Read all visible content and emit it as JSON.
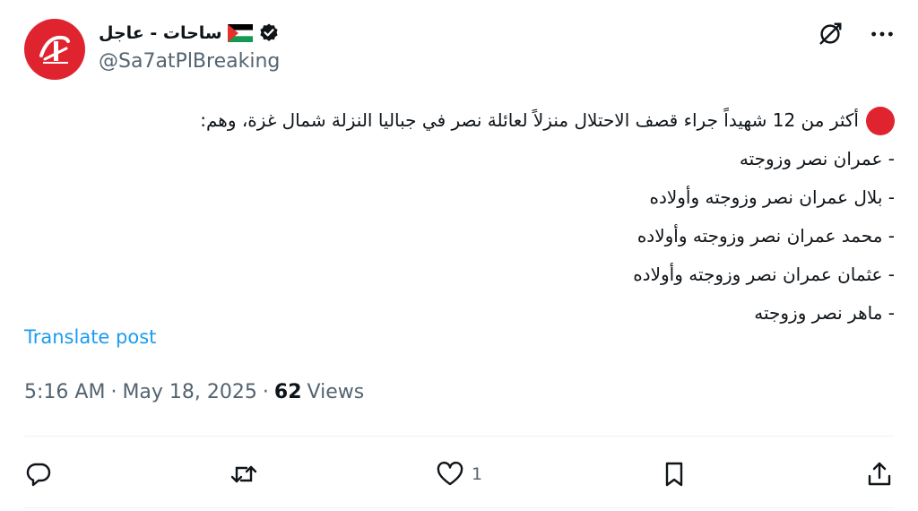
{
  "author": {
    "name": "ساحات - عاجل",
    "handle": "@Sa7atPlBreaking",
    "flag_icon": "palestine-flag-icon",
    "verified_icon": "verified-badge-icon"
  },
  "tweet": {
    "lines": [
      "أكثر من 12 شهيداً جراء قصف الاحتلال منزلاً لعائلة نصر في جباليا النزلة شمال غزة، وهم:",
      "- عمران نصر وزوجته",
      "- بلال عمران نصر وزوجته وأولاده",
      "- محمد عمران نصر وزوجته وأولاده",
      "- عثمان عمران نصر وزوجته وأولاده",
      "- ماهر نصر وزوجته"
    ]
  },
  "translate_label": "Translate post",
  "meta": {
    "time": "5:16 AM",
    "dot1": "·",
    "date": "May 18, 2025",
    "dot2": "·",
    "views_count": "62",
    "views_label": "Views"
  },
  "actions": {
    "reply_icon": "reply-icon",
    "repost_icon": "repost-icon",
    "like_icon": "heart-icon",
    "like_count": "1",
    "bookmark_icon": "bookmark-icon",
    "share_icon": "share-icon"
  },
  "colors": {
    "accent": "#1d9bf0",
    "brand_red": "#e0242f",
    "muted": "#536471"
  }
}
